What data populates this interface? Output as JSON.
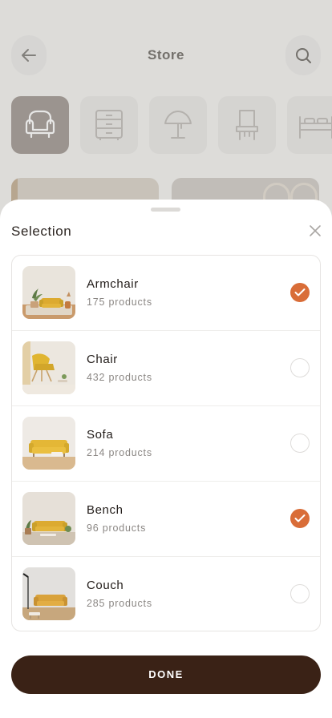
{
  "store": {
    "title": "Store",
    "back_icon": "arrow-left-icon",
    "search_icon": "search-icon",
    "categories": [
      {
        "icon": "armchair-icon",
        "active": true
      },
      {
        "icon": "dresser-icon",
        "active": false
      },
      {
        "icon": "lamp-icon",
        "active": false
      },
      {
        "icon": "chair-icon",
        "active": false
      },
      {
        "icon": "bed-icon",
        "active": false
      }
    ]
  },
  "sheet": {
    "title": "Selection",
    "close_icon": "close-icon",
    "items": [
      {
        "name": "Armchair",
        "count": "175 products",
        "selected": true
      },
      {
        "name": "Chair",
        "count": "432 products",
        "selected": false
      },
      {
        "name": "Sofa",
        "count": "214 products",
        "selected": false
      },
      {
        "name": "Bench",
        "count": "96 products",
        "selected": true
      },
      {
        "name": "Couch",
        "count": "285 products",
        "selected": false
      }
    ],
    "done_label": "DONE"
  },
  "colors": {
    "accent": "#d96d38",
    "button": "#3a2216",
    "sofa": "#d9ac2c"
  }
}
